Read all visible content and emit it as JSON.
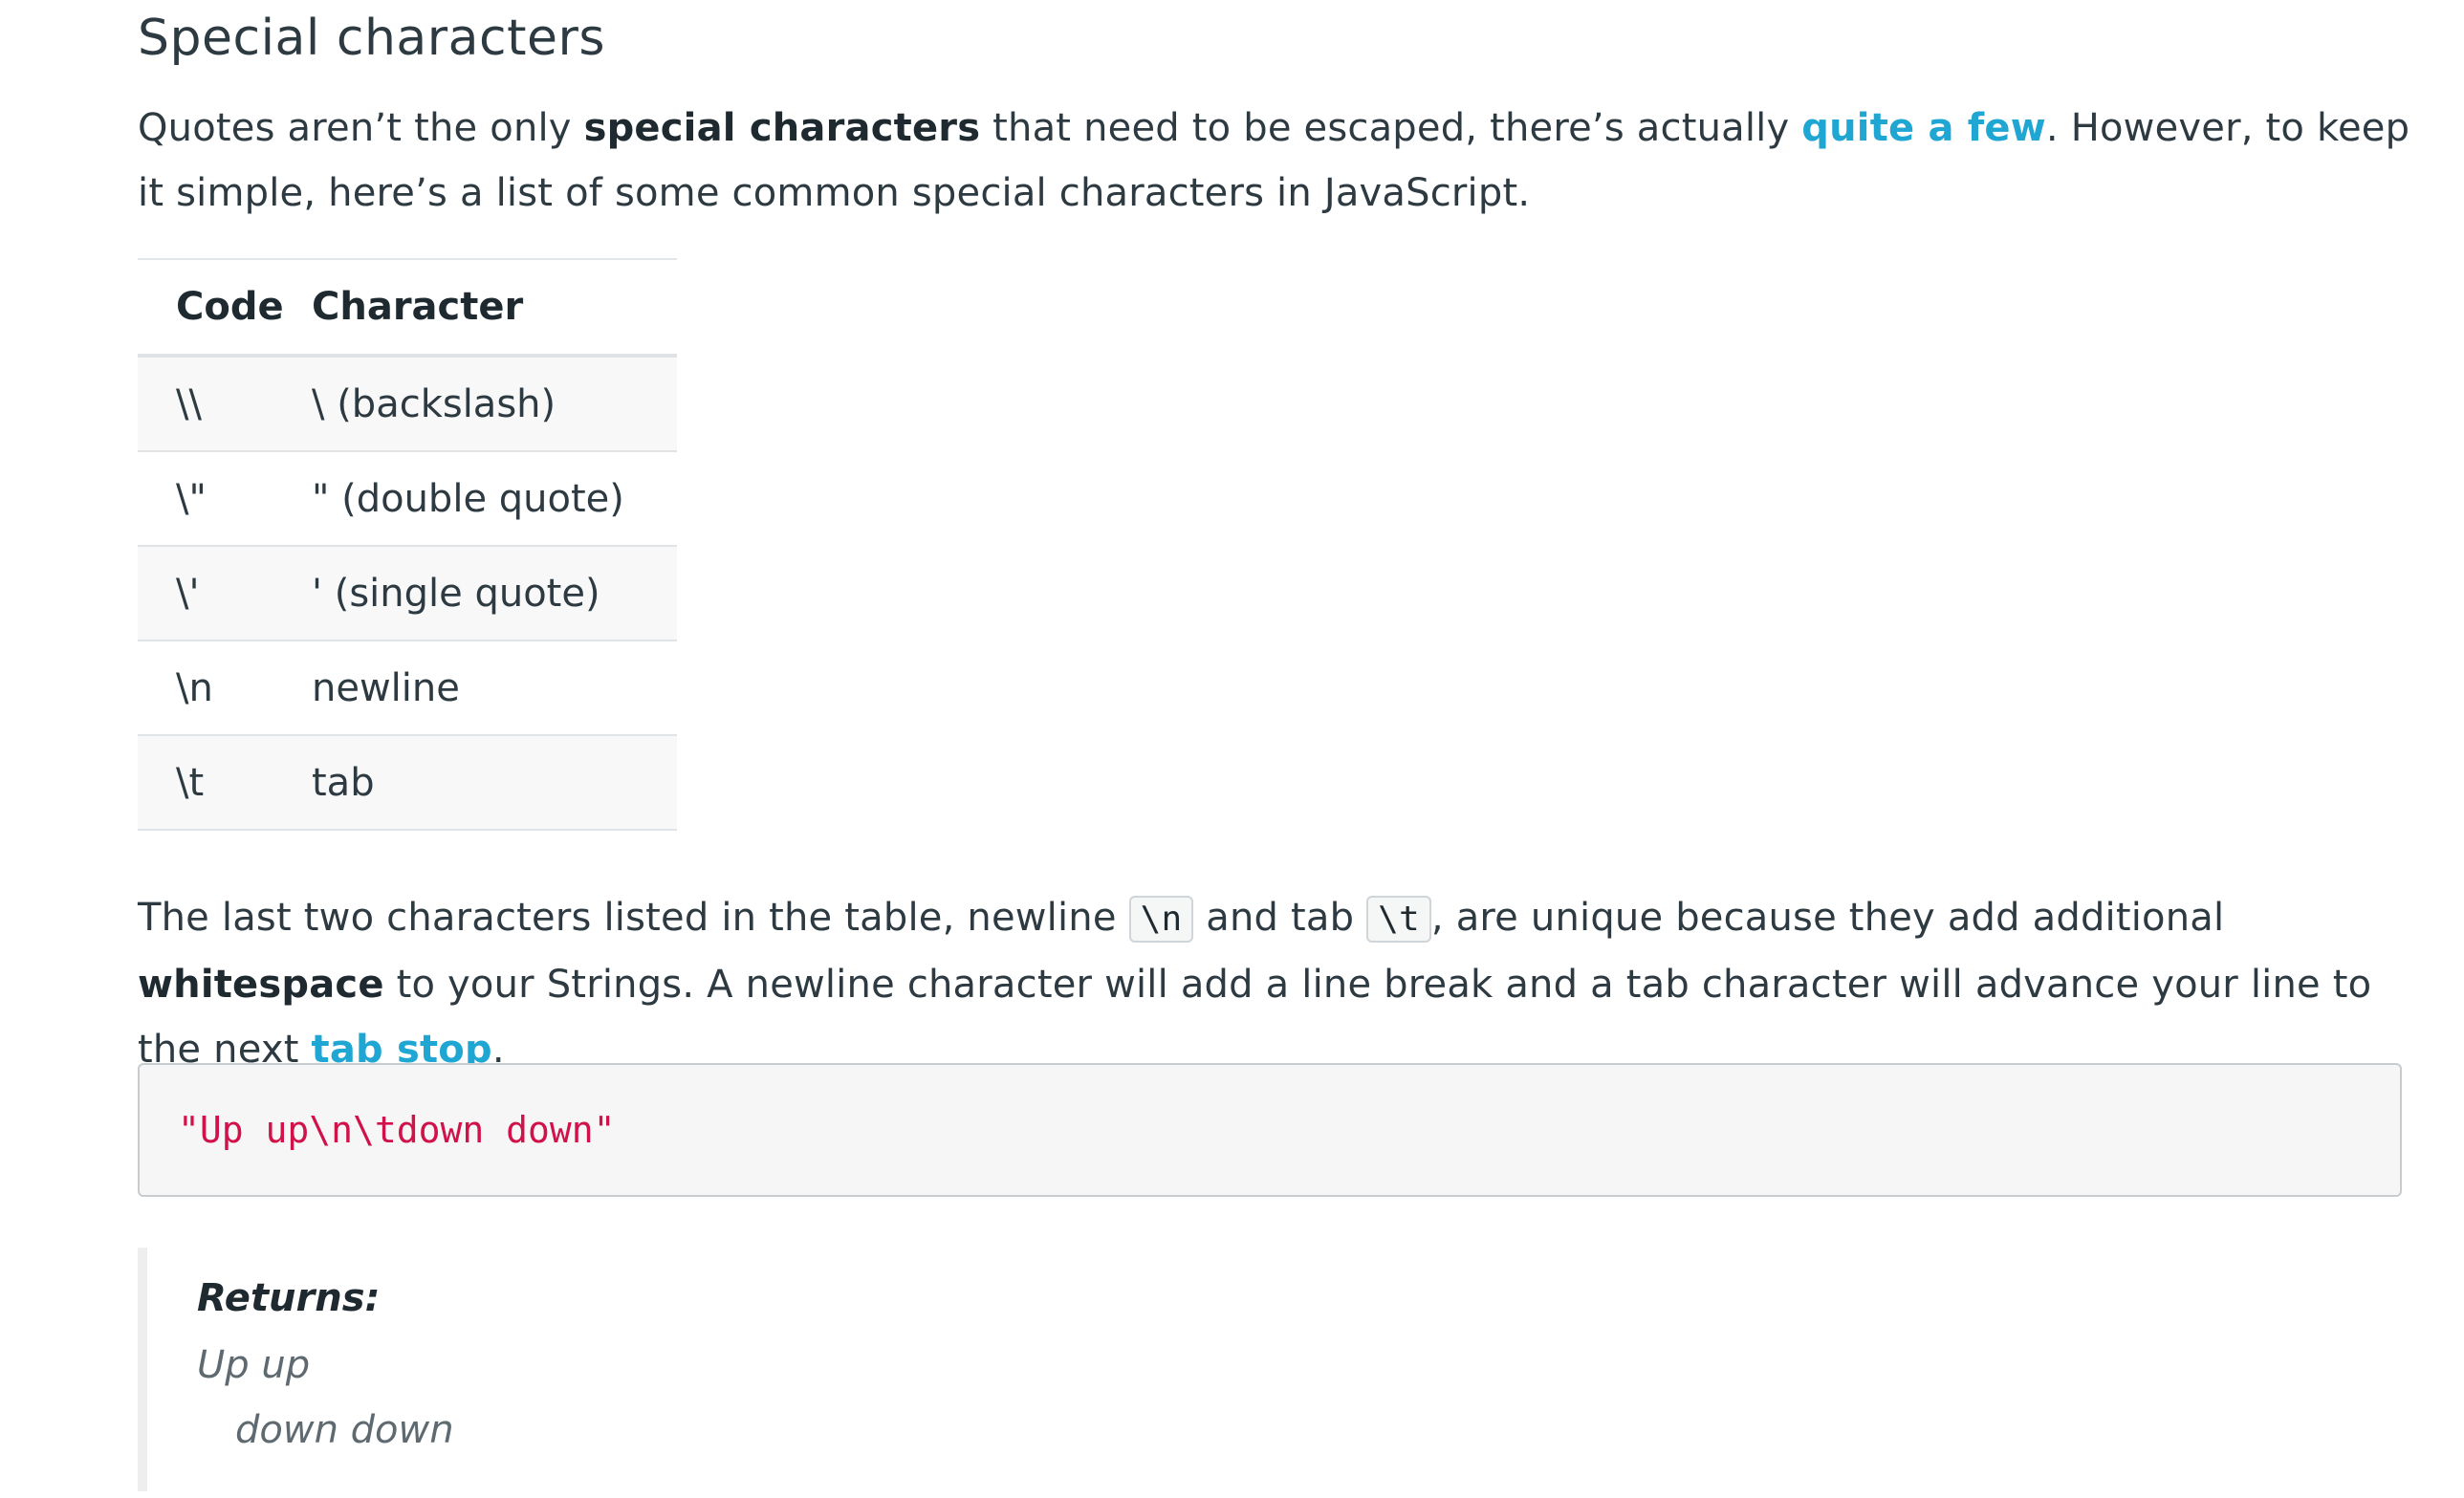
{
  "section": {
    "title": "Special characters"
  },
  "intro": {
    "t1": "Quotes aren’t the only ",
    "b1": "special characters",
    "t2": " that need to be escaped, there’s actually ",
    "link1": "quite a few",
    "t3": ". However, to keep it simple, here’s a list of some common special characters in JavaScript."
  },
  "table": {
    "headers": [
      "Code",
      "Character"
    ],
    "rows": [
      {
        "code": "\\\\",
        "character": "\\ (backslash)"
      },
      {
        "code": "\\\"",
        "character": "\" (double quote)"
      },
      {
        "code": "\\'",
        "character": "' (single quote)"
      },
      {
        "code": "\\n",
        "character": "newline"
      },
      {
        "code": "\\t",
        "character": "tab"
      }
    ]
  },
  "para2": {
    "t1": "The last two characters listed in the table, newline ",
    "code1": "\\n",
    "t2": " and tab ",
    "code2": "\\t",
    "t3": ", are unique because they add additional ",
    "b1": "whitespace",
    "t4": " to your Strings. A newline character will add a line break and a tab character will advance your line to the next ",
    "link1": "tab stop",
    "t5": "."
  },
  "code_block": {
    "code": "\"Up up\\n\\tdown down\""
  },
  "returns": {
    "label": "Returns:",
    "line1": "Up up",
    "line2": "down down"
  },
  "colors": {
    "link": "#1fa6d3",
    "code_string": "#d1124a",
    "text": "#2d3a41"
  }
}
